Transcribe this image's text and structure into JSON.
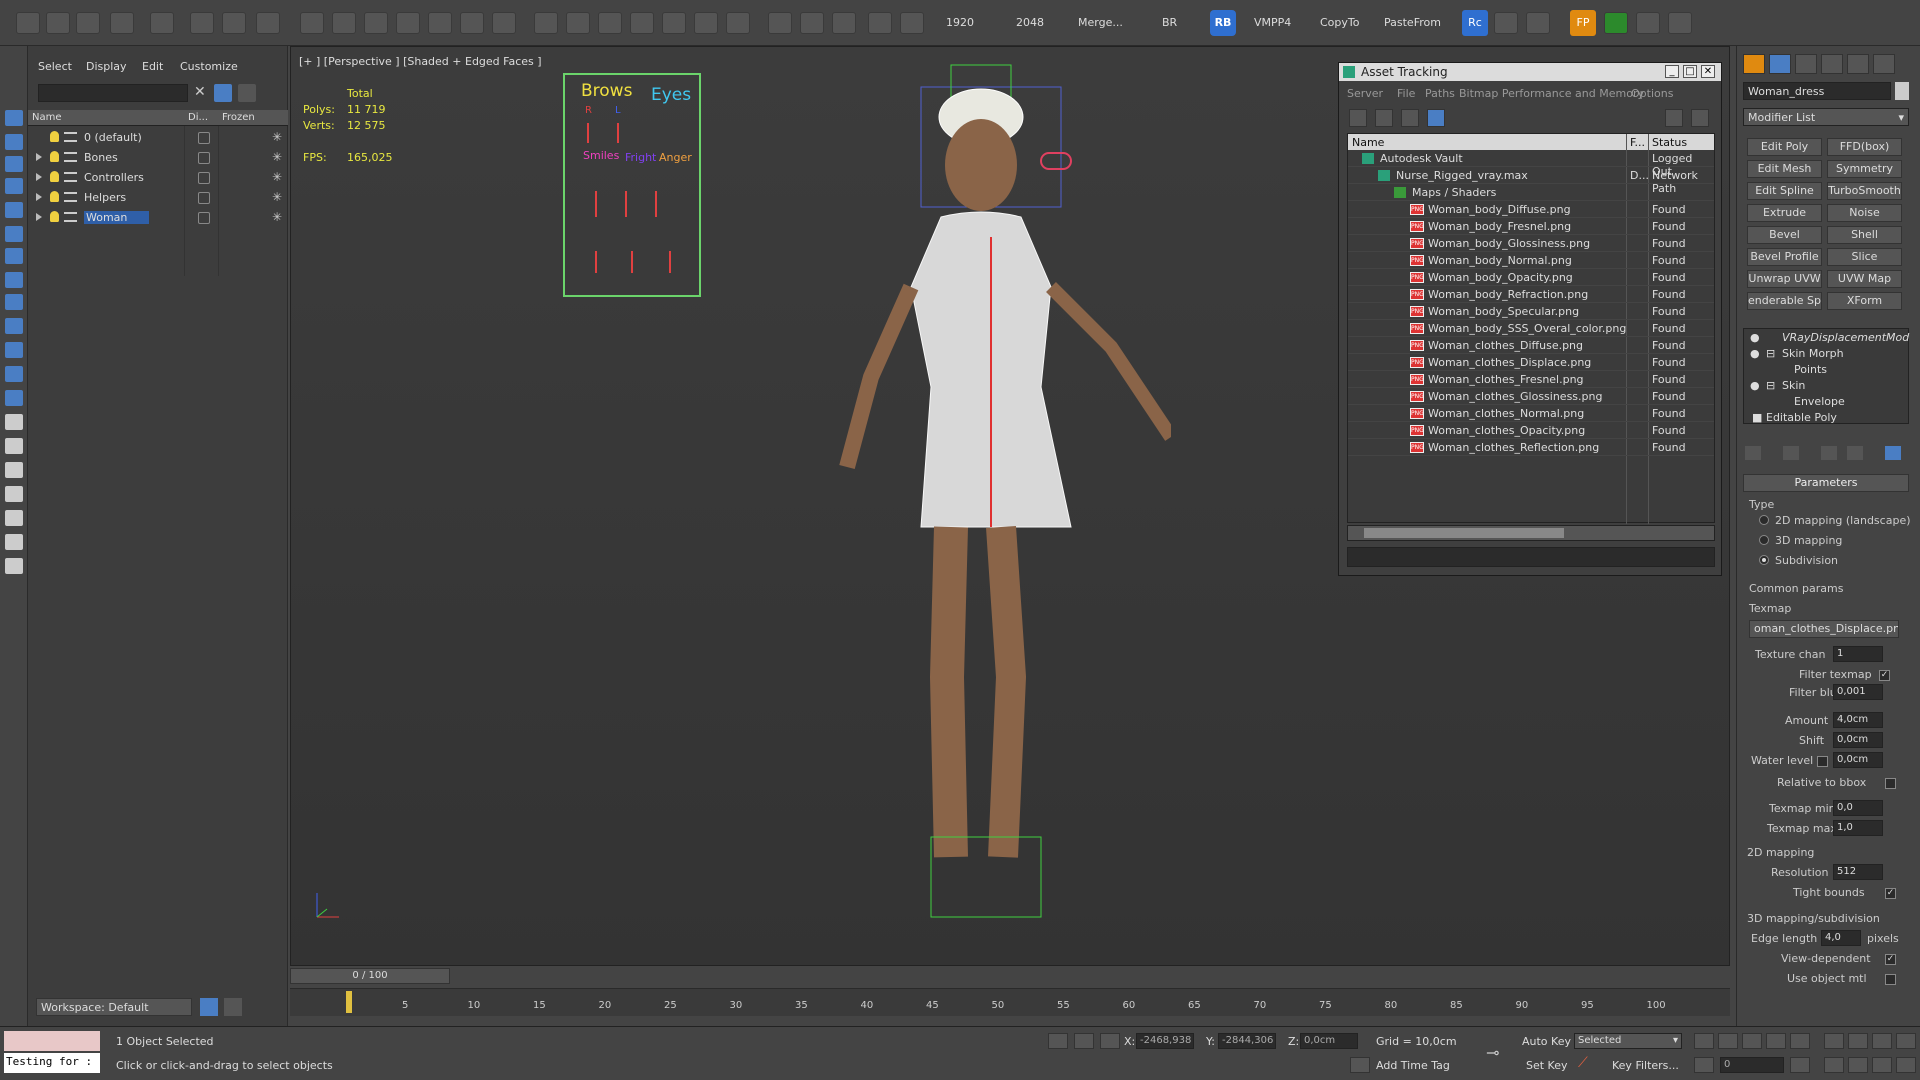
{
  "toolbar": {
    "labels": [
      "1920",
      "2048",
      "Merge...",
      "BR",
      "RB",
      "VMPP4",
      "CopyTo",
      "PasteFrom",
      "Rc",
      "FP"
    ]
  },
  "scene_explorer": {
    "menu": [
      "Select",
      "Display",
      "Edit",
      "Customize"
    ],
    "columns": [
      "Name",
      "Di...",
      "Frozen"
    ],
    "rows": [
      "0 (default)",
      "Bones",
      "Controllers",
      "Helpers",
      "Woman"
    ],
    "workspace": "Workspace: Default"
  },
  "viewport": {
    "label": "[+ ] [Perspective ] [Shaded + Edged Faces ]",
    "stats": {
      "total_label": "Total",
      "polys_label": "Polys:",
      "polys": "11 719",
      "verts_label": "Verts:",
      "verts": "12 575",
      "fps_label": "FPS:",
      "fps": "165,025"
    },
    "face_panel": {
      "brows": "Brows",
      "eyes": "Eyes",
      "r": "R",
      "l": "L",
      "smiles": "Smiles",
      "fright": "Fright",
      "anger": "Anger"
    }
  },
  "asset_tracking": {
    "title": "Asset Tracking",
    "menu": [
      "Server",
      "File",
      "Paths",
      "Bitmap Performance and Memory",
      "Options"
    ],
    "columns": [
      "Name",
      "F...",
      "Status"
    ],
    "rows": [
      {
        "name": "Autodesk Vault",
        "status": "Logged Out",
        "indent": 0
      },
      {
        "name": "Nurse_Rigged_vray.max",
        "status": "Network Path",
        "d": "D...",
        "indent": 1
      },
      {
        "name": "Maps / Shaders",
        "status": "",
        "indent": 2
      },
      {
        "name": "Woman_body_Diffuse.png",
        "status": "Found",
        "indent": 3
      },
      {
        "name": "Woman_body_Fresnel.png",
        "status": "Found",
        "indent": 3
      },
      {
        "name": "Woman_body_Glossiness.png",
        "status": "Found",
        "indent": 3
      },
      {
        "name": "Woman_body_Normal.png",
        "status": "Found",
        "indent": 3
      },
      {
        "name": "Woman_body_Opacity.png",
        "status": "Found",
        "indent": 3
      },
      {
        "name": "Woman_body_Refraction.png",
        "status": "Found",
        "indent": 3
      },
      {
        "name": "Woman_body_Specular.png",
        "status": "Found",
        "indent": 3
      },
      {
        "name": "Woman_body_SSS_Overal_color.png",
        "status": "Found",
        "indent": 3
      },
      {
        "name": "Woman_clothes_Diffuse.png",
        "status": "Found",
        "indent": 3
      },
      {
        "name": "Woman_clothes_Displace.png",
        "status": "Found",
        "indent": 3
      },
      {
        "name": "Woman_clothes_Fresnel.png",
        "status": "Found",
        "indent": 3
      },
      {
        "name": "Woman_clothes_Glossiness.png",
        "status": "Found",
        "indent": 3
      },
      {
        "name": "Woman_clothes_Normal.png",
        "status": "Found",
        "indent": 3
      },
      {
        "name": "Woman_clothes_Opacity.png",
        "status": "Found",
        "indent": 3
      },
      {
        "name": "Woman_clothes_Reflection.png",
        "status": "Found",
        "indent": 3
      }
    ]
  },
  "command_panel": {
    "object_name": "Woman_dress",
    "modifier_list": "Modifier List",
    "buttons": [
      "Edit Poly",
      "FFD(box)",
      "Edit Mesh",
      "Symmetry",
      "Edit Spline",
      "TurboSmooth",
      "Extrude",
      "Noise",
      "Bevel",
      "Shell",
      "Bevel Profile",
      "Slice",
      "Unwrap UVW",
      "UVW Map",
      "enderable Splin",
      "XForm"
    ],
    "stack": [
      "VRayDisplacementMod",
      "Skin Morph",
      "Points",
      "Skin",
      "Envelope",
      "Editable Poly"
    ],
    "parameters": {
      "header": "Parameters",
      "type_label": "Type",
      "type_options": [
        "2D mapping (landscape)",
        "3D mapping",
        "Subdivision"
      ],
      "common": "Common params",
      "texmap_label": "Texmap",
      "texmap": "oman_clothes_Displace.png)",
      "texture_chan_label": "Texture chan",
      "texture_chan": "1",
      "filter_texmap": "Filter texmap",
      "filter_blur_label": "Filter blur",
      "filter_blur": "0,001",
      "amount_label": "Amount",
      "amount": "4,0cm",
      "shift_label": "Shift",
      "shift": "0,0cm",
      "water_label": "Water level",
      "water": "0,0cm",
      "relative": "Relative to bbox",
      "texmap_min_label": "Texmap min",
      "texmap_min": "0,0",
      "texmap_max_label": "Texmap max",
      "texmap_max": "1,0",
      "mapping2d": "2D mapping",
      "resolution_label": "Resolution",
      "resolution": "512",
      "tight": "Tight bounds",
      "mapping3d": "3D mapping/subdivision",
      "edge_label": "Edge length",
      "edge": "4,0",
      "pixels": "pixels",
      "view_dep": "View-dependent",
      "use_obj": "Use object mtl"
    }
  },
  "timeline": {
    "frame": "0 / 100",
    "ticks": [
      "5",
      "10",
      "15",
      "20",
      "25",
      "30",
      "35",
      "40",
      "45",
      "50",
      "55",
      "60",
      "65",
      "70",
      "75",
      "80",
      "85",
      "90",
      "95",
      "100"
    ]
  },
  "status": {
    "script": "Testing for :",
    "selected": "1 Object Selected",
    "hint": "Click or click-and-drag to select objects",
    "x_label": "X:",
    "x": "-2468,938",
    "y_label": "Y:",
    "y": "-2844,306",
    "z_label": "Z:",
    "z": "0,0cm",
    "grid": "Grid = 10,0cm",
    "add_time_tag": "Add Time Tag",
    "auto_key": "Auto Key",
    "set_key": "Set Key",
    "selected_dd": "Selected",
    "key_filters": "Key Filters...",
    "frame_field": "0"
  }
}
